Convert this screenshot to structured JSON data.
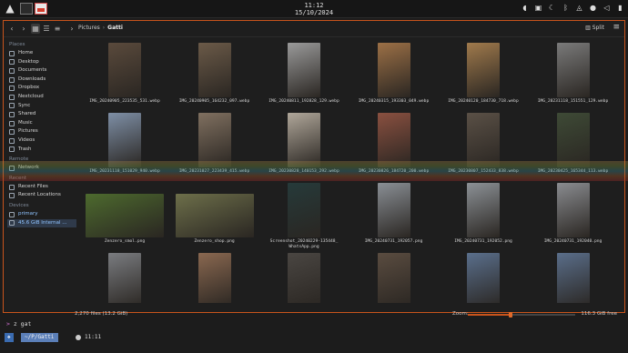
{
  "topbar": {
    "logo_icon": "arch-logo-icon",
    "clock_time": "11:12",
    "clock_date": "15/10/2024",
    "tray_icons": [
      "volume-icon",
      "camera-icon",
      "nightlight-icon",
      "bluetooth-icon",
      "network-icon",
      "microphone-icon",
      "speaker-icon",
      "battery-icon"
    ]
  },
  "toolbar": {
    "breadcrumb": [
      "Pictures",
      "Gatti"
    ],
    "split_label": "Split"
  },
  "sidebar": {
    "places_heading": "Places",
    "places": [
      "Home",
      "Desktop",
      "Documents",
      "Downloads",
      "Dropbox",
      "Nextcloud",
      "Sync",
      "Shared",
      "Music",
      "Pictures",
      "Videos",
      "Trash"
    ],
    "remote_heading": "Remote",
    "remote": [
      "Network"
    ],
    "recent_heading": "Recent",
    "recent": [
      "Recent Files",
      "Recent Locations"
    ],
    "devices_heading": "Devices",
    "devices": [
      "primary",
      "45.6 GiB Internal ..."
    ]
  },
  "files": [
    {
      "name": "IMG_20240905_223535_531.webp",
      "color": "#5a4a3c"
    },
    {
      "name": "IMG_20240905_164232_097.webp",
      "color": "#6b5a48"
    },
    {
      "name": "IMG_20240811_192828_129.webp",
      "color": "#9a9a9a"
    },
    {
      "name": "IMG_20240315_193303_049.webp",
      "color": "#9c7046"
    },
    {
      "name": "IMG_20240120_184730_718.webp",
      "color": "#a07a4c"
    },
    {
      "name": "IMG_20231118_151551_129.webp",
      "color": "#7a7a7a"
    },
    {
      "name": "IMG_20231118_151029_940.webp",
      "color": "#7e8fa6"
    },
    {
      "name": "IMG_20231027_223439_415.webp",
      "color": "#807060"
    },
    {
      "name": "IMG_20230828_140153_292.webp",
      "color": "#b0a79a"
    },
    {
      "name": "IMG_20230826_184720_200.webp",
      "color": "#8a5040"
    },
    {
      "name": "IMG_20230807_152433_838.webp",
      "color": "#5a5046"
    },
    {
      "name": "IMG_20230425_165344_113.webp",
      "color": "#3e4a36"
    },
    {
      "name": "Zenzero_smol.png",
      "color": "#4d6a2e"
    },
    {
      "name": "Zenzero_shop.png",
      "color": "#6d6f4a"
    },
    {
      "name": "Screenshot_20240229-135448_\nWhatsApp.png",
      "color": "#263a3a"
    },
    {
      "name": "IMG_20240731_192057.png",
      "color": "#8a8f95"
    },
    {
      "name": "IMG_20240731_192052.png",
      "color": "#8c9196"
    },
    {
      "name": "IMG_20240731_192040.png",
      "color": "#8a8c90"
    },
    {
      "name": "",
      "color": "#7a7c80"
    },
    {
      "name": "",
      "color": "#8a6850"
    },
    {
      "name": "",
      "color": "#4a4642"
    },
    {
      "name": "",
      "color": "#5a4c40"
    },
    {
      "name": "",
      "color": "#5a6f8c"
    },
    {
      "name": "",
      "color": "#5a6e8a"
    }
  ],
  "status": {
    "file_count": "2,270 files (13.2 GiB)",
    "zoom_label": "Zoom:",
    "zoom_fraction": 0.4,
    "free_space": "116.3 GiB free"
  },
  "terminal": {
    "prompt_symbol": ">",
    "command": "z gat",
    "tmux_logo": "",
    "tmux_path": "~/P/Gatti",
    "tmux_time": "11:11"
  },
  "colors": {
    "accent": "#c8541c",
    "selection": "#2f3a4a"
  }
}
